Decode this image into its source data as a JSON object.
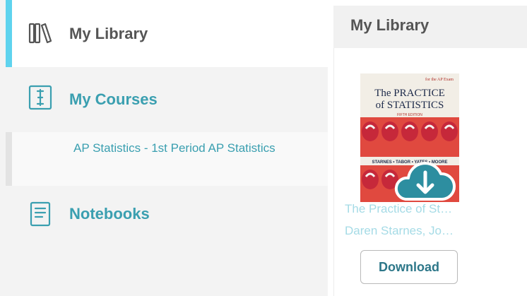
{
  "sidebar": {
    "items": [
      {
        "label": "My Library",
        "icon": "books-icon"
      },
      {
        "label": "My Courses",
        "icon": "course-icon"
      },
      {
        "label": "Notebooks",
        "icon": "notebook-icon"
      }
    ],
    "course_sub_items": [
      {
        "label": "AP Statistics - 1st Period AP Statistics"
      }
    ]
  },
  "main": {
    "title": "My Library",
    "books": [
      {
        "cover_heading": "The PRACTICE of STATISTICS",
        "cover_heading_line1": "The PRACTICE",
        "cover_heading_line2": "of STATISTICS",
        "cover_edition": "FIFTH EDITION",
        "cover_top": "for the AP Exam",
        "cover_authors": "STARNES • TABOR • YATES • MOORE",
        "title_truncated": "The Practice of St…",
        "author_truncated": "Daren Starnes, Jo…",
        "download_label": "Download",
        "overlay_icon": "cloud-download-icon"
      }
    ]
  },
  "colors": {
    "accent": "#5fd3ee",
    "link": "#3a9fb0",
    "faded_link": "#a5dbe6",
    "button_text": "#2d7789"
  }
}
